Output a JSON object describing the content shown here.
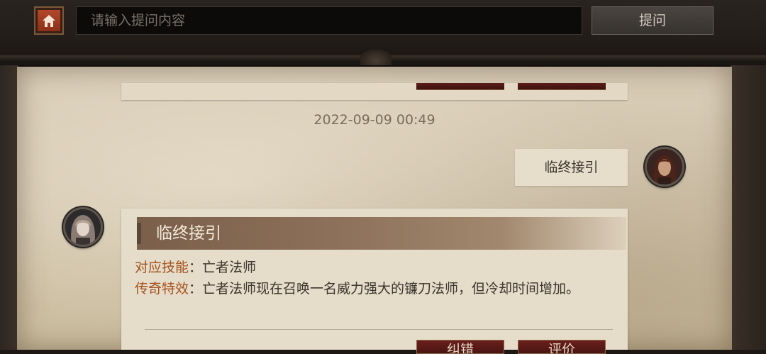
{
  "header": {
    "search_placeholder": "请输入提问内容",
    "ask_label": "提问",
    "home_icon": "home-icon"
  },
  "conversation": {
    "timestamp": "2022-09-09 00:49",
    "user_message": "临终接引",
    "answer": {
      "title": "临终接引",
      "skill_key": "对应技能",
      "skill_value": "亡者法师",
      "legendary_key": "传奇特效",
      "legendary_value": "亡者法师现在召唤一名威力强大的镰刀法师，但冷却时间增加。",
      "separator": "："
    },
    "actions": {
      "correct_label": "纠错",
      "rate_label": "评价"
    }
  },
  "colors": {
    "accent": "#a4521e",
    "home_button": "#b2472a",
    "action_button": "#5a1d1a"
  }
}
